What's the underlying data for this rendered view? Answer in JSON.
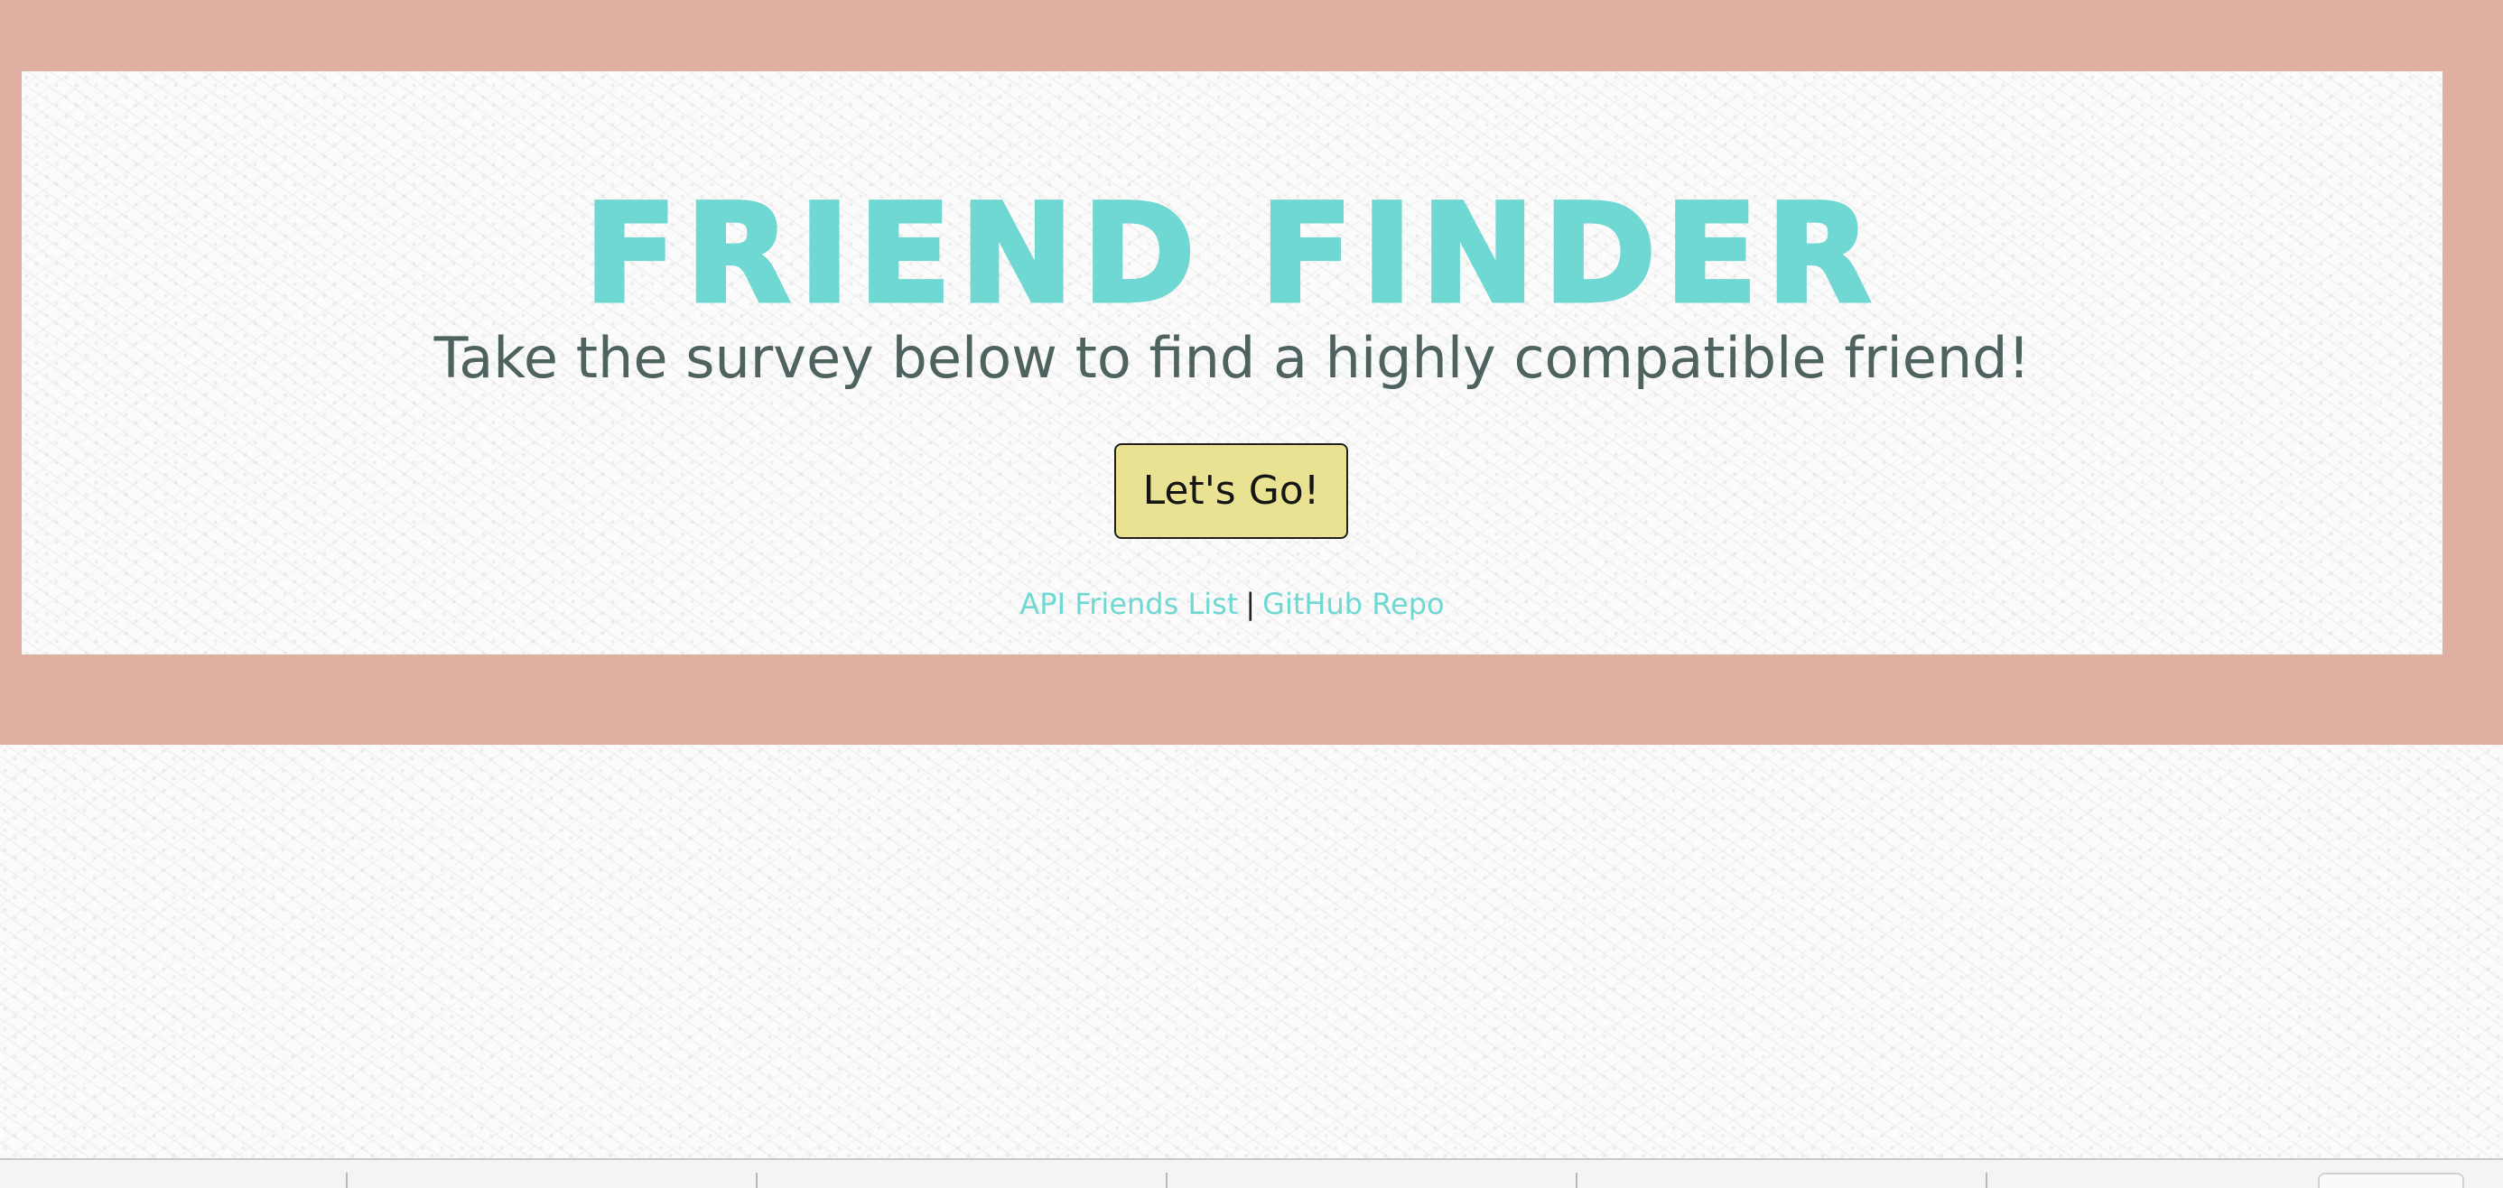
{
  "hero": {
    "title": "Friend Finder",
    "subtitle": "Take the survey below to find a highly compatible friend!",
    "cta_label": "Let's Go!"
  },
  "links": {
    "api_friends": "API Friends List",
    "separator": "|",
    "github": "GitHub Repo"
  },
  "colors": {
    "hero_band": "#dfafa2",
    "title": "#6fd8d3",
    "subtitle": "#4e6260",
    "button": "#e9e293",
    "link": "#6fd8d3"
  }
}
